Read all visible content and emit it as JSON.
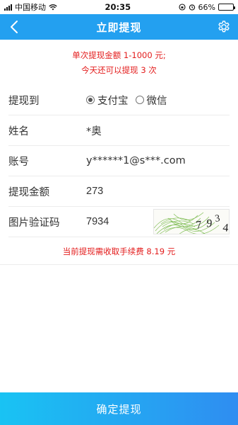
{
  "status": {
    "carrier": "中国移动",
    "time": "20:35",
    "battery": "66%"
  },
  "nav": {
    "title": "立即提现",
    "back_icon": "chevron-left-icon",
    "settings_icon": "gear-icon"
  },
  "notice": {
    "line1": "单次提现金额 1-1000 元;",
    "line2": "今天还可以提现 3 次"
  },
  "form": {
    "to_label": "提现到",
    "options": {
      "alipay": "支付宝",
      "wechat": "微信",
      "selected": "alipay"
    },
    "name_label": "姓名",
    "name_value": "*奥",
    "account_label": "账号",
    "account_value": "y******1@s***.com",
    "amount_label": "提现金额",
    "amount_value": "273",
    "captcha_label": "图片验证码",
    "captcha_value": "7934",
    "captcha_image_text": "7934"
  },
  "fee_text": "当前提现需收取手续费 8.19 元",
  "confirm_label": "确定提现",
  "colors": {
    "primary": "#23a0f0",
    "warning": "#e31b1b",
    "button_start": "#19c3f3",
    "button_end": "#2f8df1"
  }
}
